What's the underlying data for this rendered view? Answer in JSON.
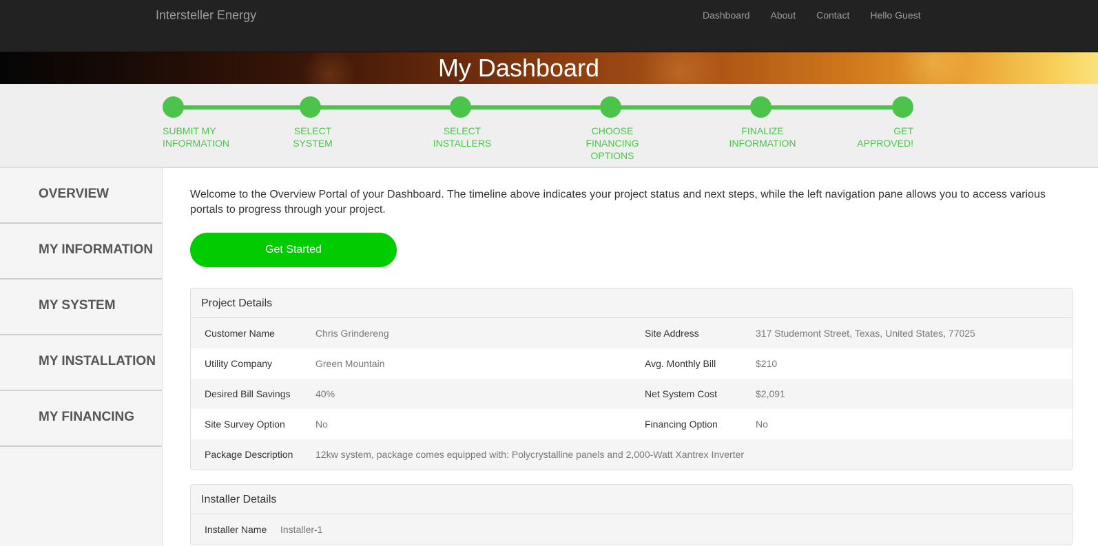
{
  "navbar": {
    "brand": "Intersteller Energy",
    "links": [
      "Dashboard",
      "About",
      "Contact",
      "Hello Guest"
    ]
  },
  "hero": {
    "title": "My Dashboard"
  },
  "timeline": {
    "color": "#4cc44c",
    "steps": [
      {
        "line1": "SUBMIT MY",
        "line2": "INFORMATION",
        "line3": ""
      },
      {
        "line1": "SELECT",
        "line2": "SYSTEM",
        "line3": ""
      },
      {
        "line1": "SELECT",
        "line2": "INSTALLERS",
        "line3": ""
      },
      {
        "line1": "CHOOSE",
        "line2": "FINANCING",
        "line3": "OPTIONS"
      },
      {
        "line1": "FINALIZE",
        "line2": "INFORMATION",
        "line3": ""
      },
      {
        "line1": "GET",
        "line2": "APPROVED!",
        "line3": ""
      }
    ]
  },
  "sidebar": {
    "items": [
      "OVERVIEW",
      "MY INFORMATION",
      "MY SYSTEM",
      "MY INSTALLATION",
      "MY FINANCING"
    ]
  },
  "main": {
    "welcome": "Welcome to the Overview Portal of your Dashboard. The timeline above indicates your project status and next steps, while the left navigation pane allows you to access various portals to progress through your project.",
    "get_started_label": "Get Started",
    "accent": "#00cc00"
  },
  "project": {
    "heading": "Project Details",
    "rows": [
      {
        "k1": "Customer Name",
        "v1": "Chris Grindereng",
        "k2": "Site Address",
        "v2": "317 Studemont Street, Texas, United States, 77025"
      },
      {
        "k1": "Utility Company",
        "v1": "Green Mountain",
        "k2": "Avg. Monthly Bill",
        "v2": "$210"
      },
      {
        "k1": "Desired Bill Savings",
        "v1": "40%",
        "k2": "Net System Cost",
        "v2": "$2,091"
      },
      {
        "k1": "Site Survey Option",
        "v1": "No",
        "k2": "Financing Option",
        "v2": "No"
      }
    ],
    "package_label": "Package Description",
    "package_value": "12kw system, package comes equipped with: Polycrystalline panels and 2,000-Watt Xantrex Inverter"
  },
  "installer": {
    "heading": "Installer Details",
    "name_label": "Installer Name",
    "name_value": "Installer-1"
  }
}
